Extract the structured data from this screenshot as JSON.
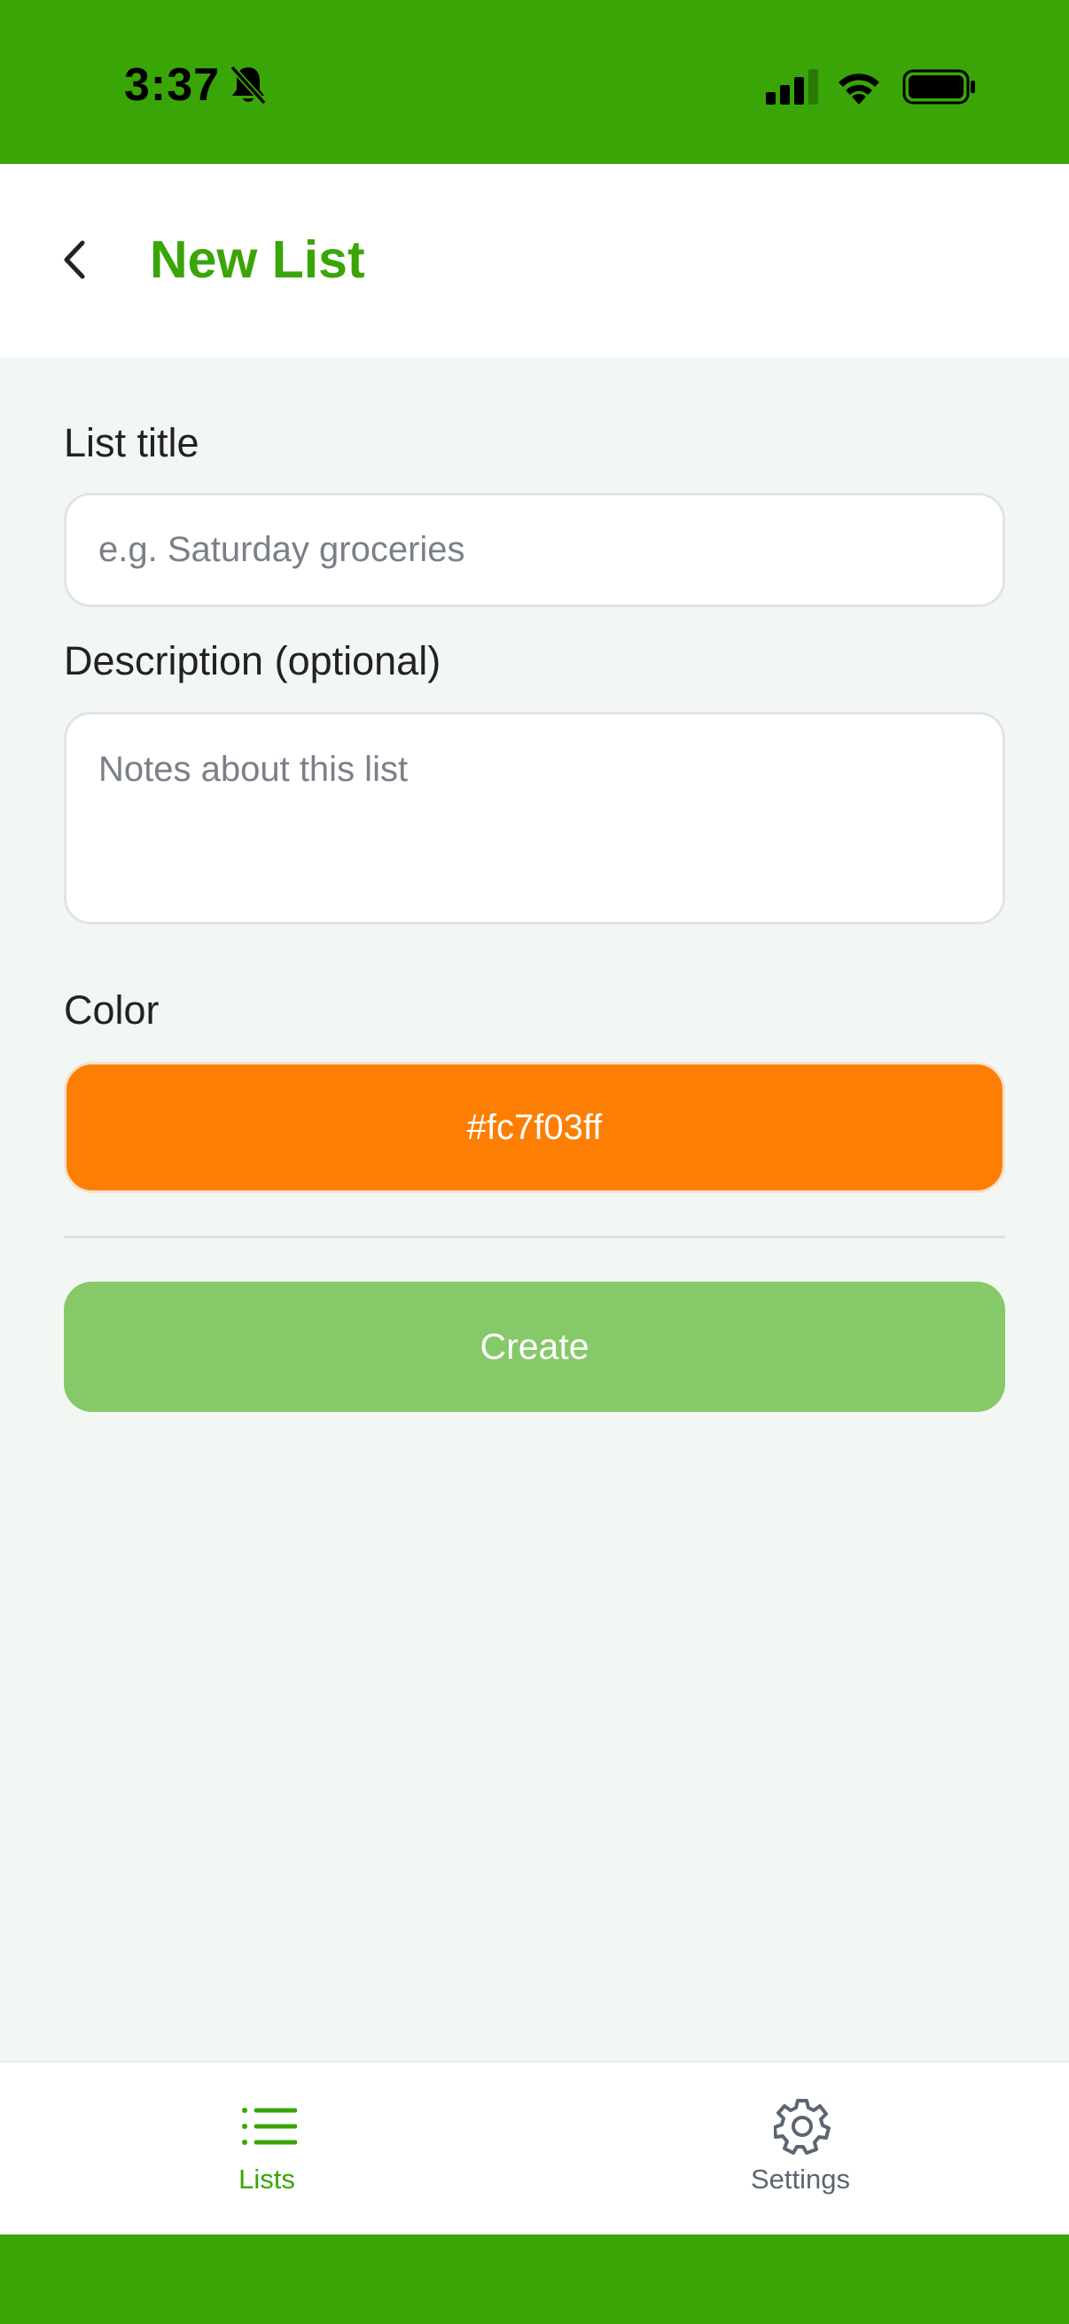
{
  "status_bar": {
    "time": "3:37",
    "icons": [
      "bell-slash-icon",
      "cellular-signal-icon",
      "wifi-icon",
      "battery-icon"
    ]
  },
  "header": {
    "back_icon": "chevron-left-icon",
    "title": "New List"
  },
  "form": {
    "title_label": "List title",
    "title_value": "",
    "title_placeholder": "e.g. Saturday groceries",
    "description_label": "Description (optional)",
    "description_value": "",
    "description_placeholder": "Notes about this list",
    "color_label": "Color",
    "color_value": "#fc7f03ff",
    "create_label": "Create"
  },
  "tabs": [
    {
      "label": "Lists",
      "icon": "list-icon",
      "active": true
    },
    {
      "label": "Settings",
      "icon": "gear-icon",
      "active": false
    }
  ],
  "colors": {
    "brand": "#3aa507",
    "selected_color": "#fc7f03",
    "create_button": "#86c968",
    "background": "#f2f7f3"
  }
}
